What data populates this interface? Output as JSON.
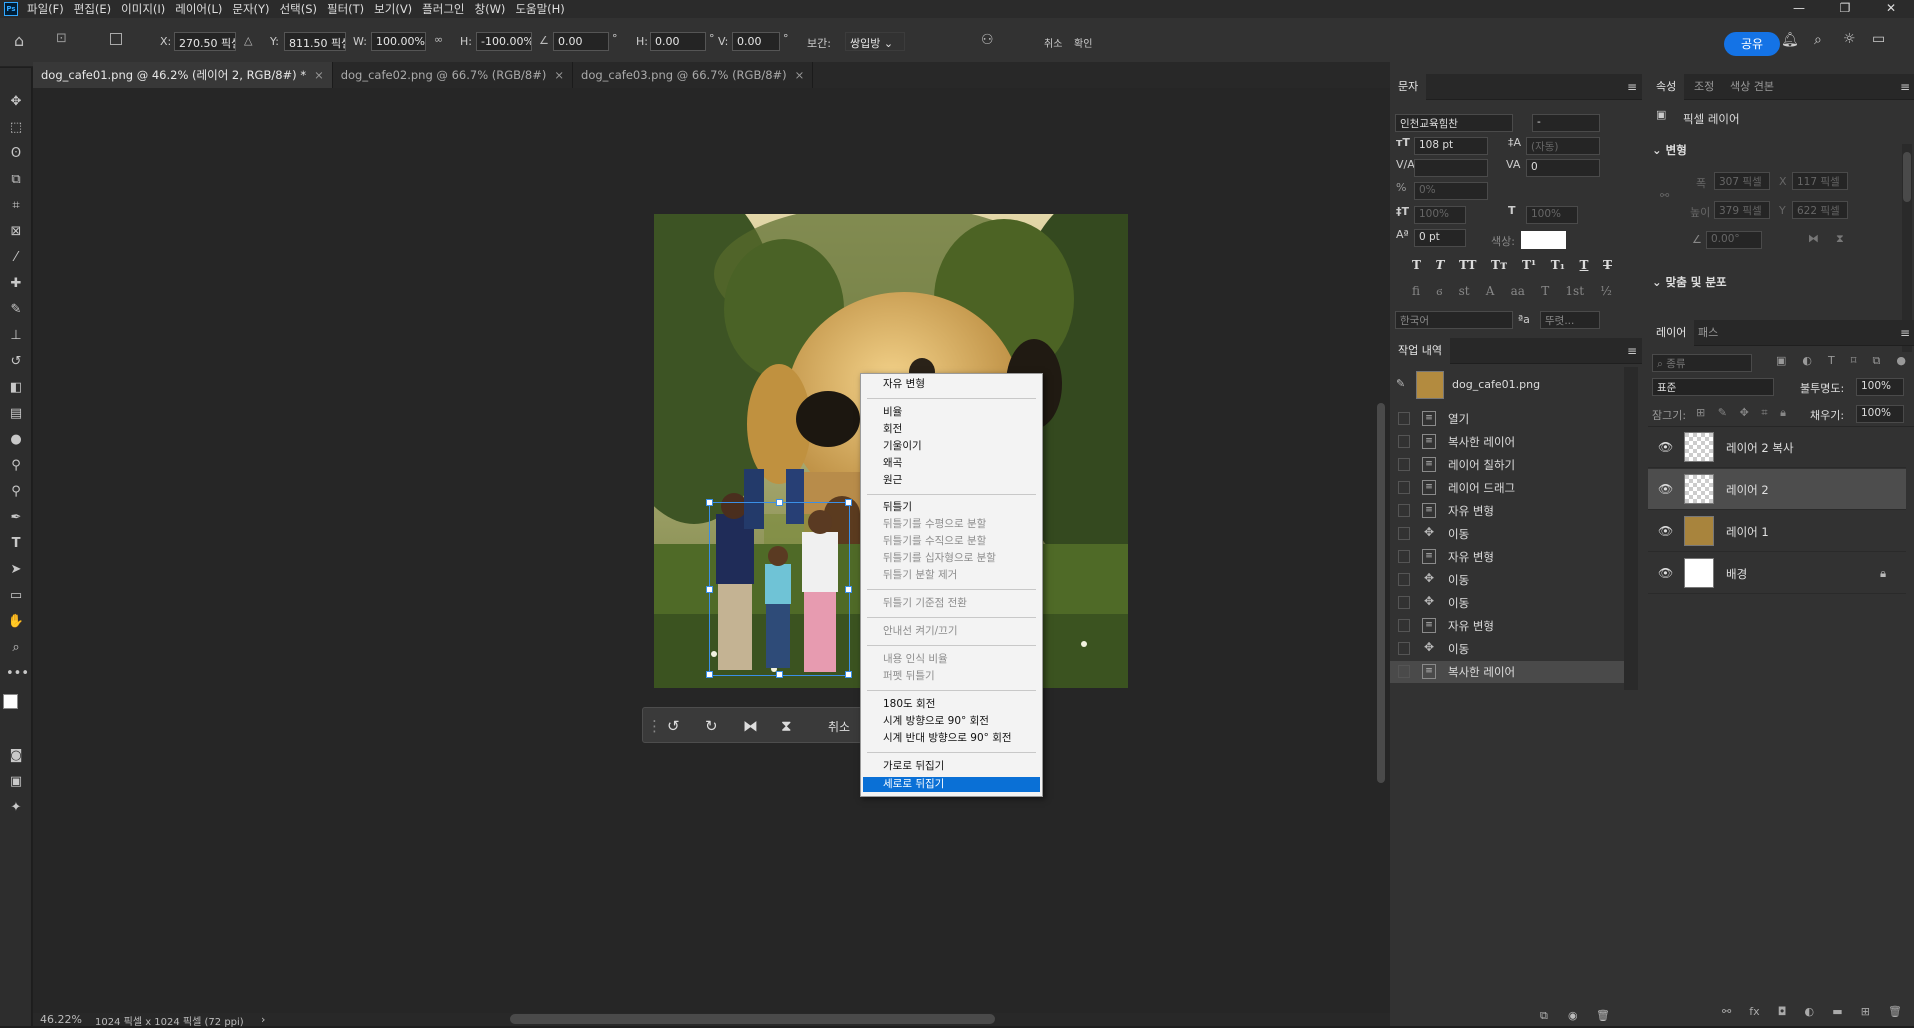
{
  "menubar": {
    "logo": "Ps",
    "items": [
      "파일(F)",
      "편집(E)",
      "이미지(I)",
      "레이어(L)",
      "문자(Y)",
      "선택(S)",
      "필터(T)",
      "보기(V)",
      "플러그인",
      "창(W)",
      "도움말(H)"
    ],
    "window_controls": [
      "—",
      "❐",
      "✕"
    ]
  },
  "options": {
    "x_label": "X:",
    "x_value": "270.50 픽셀",
    "y_label": "Y:",
    "y_value": "811.50 픽셀",
    "w_label": "W:",
    "w_value": "100.00%",
    "h_label": "H:",
    "h_value": "-100.00%",
    "angle_value": "0.00",
    "angle_unit": "°",
    "hskew_label": "H:",
    "hskew_value": "0.00",
    "vskew_label": "V:",
    "vskew_value": "0.00",
    "deg": "°",
    "interp_label": "보간:",
    "interp_value": "쌍입방",
    "cancel_label": "취소",
    "commit_label": "확인",
    "share_label": "공유"
  },
  "tabs": [
    {
      "label": "dog_cafe01.png @ 46.2% (레이어 2, RGB/8#) *",
      "active": true
    },
    {
      "label": "dog_cafe02.png @ 66.7% (RGB/8#)",
      "active": false
    },
    {
      "label": "dog_cafe03.png @ 66.7% (RGB/8#)",
      "active": false
    }
  ],
  "tab_close": "×",
  "status": {
    "zoom": "46.22%",
    "doc": "1024 픽셀 x 1024 픽셀 (72 ppi)",
    "arrow": "›"
  },
  "transform_bar": {
    "cancel": "취소"
  },
  "context_menu": {
    "g1": [
      "자유 변형"
    ],
    "g2": [
      "비율",
      "회전",
      "기울이기",
      "왜곡",
      "원근"
    ],
    "g3": [
      "뒤틀기",
      "뒤틀기를 수평으로 분할",
      "뒤틀기를 수직으로 분할",
      "뒤틀기를 십자형으로 분할",
      "뒤틀기 분할 제거"
    ],
    "g4": [
      "뒤틀기 기준점 전환"
    ],
    "g5": [
      "안내선 켜기/끄기"
    ],
    "g6": [
      "내용 인식 비율",
      "퍼펫 뒤틀기"
    ],
    "g7": [
      "180도 회전",
      "시계 방향으로 90° 회전",
      "시계 반대 방향으로 90° 회전"
    ],
    "g8": [
      "가로로 뒤집기",
      "세로로 뒤집기"
    ]
  },
  "char_panel": {
    "tab": "문자",
    "font": "인천교육힘찬",
    "style": "-",
    "size": "108 pt",
    "leading": "(자동)",
    "kerning": "",
    "tracking": "0",
    "scale_pct": "0%",
    "vscale": "100%",
    "hscale": "100%",
    "baseline": "0 pt",
    "color_label": "색상:",
    "lang": "한국어",
    "aa": "뚜렷...",
    "aa_icon": "ªa",
    "style_buttons": [
      "T",
      "T",
      "TT",
      "Tт",
      "T¹",
      "T₁",
      "T",
      "T"
    ],
    "otf_buttons": [
      "fi",
      "ϭ",
      "st",
      "A",
      "aa",
      "T",
      "1st",
      "½"
    ]
  },
  "history_panel": {
    "tab": "작업 내역",
    "snapshot": "dog_cafe01.png",
    "items": [
      "열기",
      "복사한 레이어",
      "레이어 칠하기",
      "레이어 드래그",
      "자유 변형",
      "이동",
      "자유 변형",
      "이동",
      "이동",
      "자유 변형",
      "이동",
      "복사한 레이어"
    ]
  },
  "props_panel": {
    "tabs": [
      "속성",
      "조정",
      "색상 견본"
    ],
    "layer_type": "픽셀 레이어",
    "transform_header": "변형",
    "w_label": "폭",
    "w_value": "307 픽셀",
    "x_label": "X",
    "x_value": "117 픽셀",
    "h_label": "높이",
    "h_value": "379 픽셀",
    "y_label": "Y",
    "y_value": "622 픽셀",
    "angle_value": "0.00°",
    "align_header": "맞춤 및 분포"
  },
  "layers_panel": {
    "tabs": [
      "레이어",
      "패스"
    ],
    "filter_kind": "종류",
    "blend_mode": "표준",
    "opacity_label": "불투명도:",
    "opacity_value": "100%",
    "lock_label": "잠그기:",
    "fill_label": "채우기:",
    "fill_value": "100%",
    "layers": [
      {
        "name": "레이어 2 복사",
        "selected": false,
        "locked": false
      },
      {
        "name": "레이어 2",
        "selected": true,
        "locked": false
      },
      {
        "name": "레이어 1",
        "selected": false,
        "locked": false
      },
      {
        "name": "배경",
        "selected": false,
        "locked": true
      }
    ]
  },
  "colors": {
    "accent": "#1473e6",
    "menu_highlight": "#0a70d6",
    "panel_bg": "#323232",
    "canvas_bg": "#262626"
  }
}
